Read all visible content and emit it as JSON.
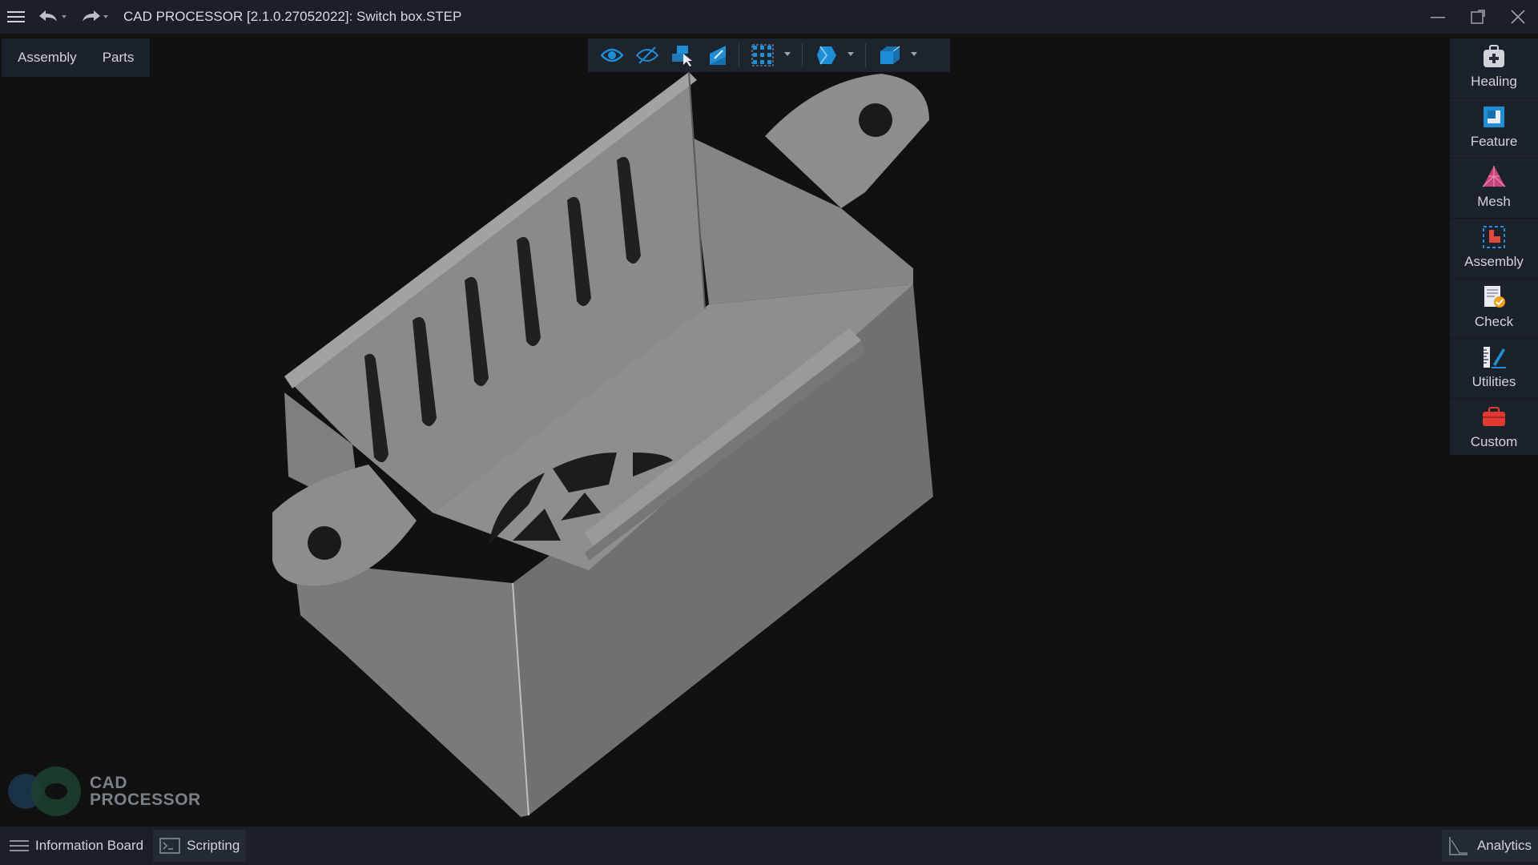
{
  "titlebar": {
    "title": "CAD PROCESSOR [2.1.0.27052022]:  Switch box.STEP",
    "icons": [
      "menu-icon",
      "undo-icon",
      "redo-icon",
      "minimize-icon",
      "restore-icon",
      "close-icon"
    ]
  },
  "left_tabs": [
    {
      "label": "Assembly"
    },
    {
      "label": "Parts"
    }
  ],
  "toolbar": {
    "icons": [
      "show-icon",
      "hide-icon",
      "select-icon",
      "section-icon",
      "grid-select-icon",
      "display-mode-icon",
      "view-cube-icon"
    ]
  },
  "right_panel": [
    {
      "label": "Healing",
      "icon": "healing-kit-icon"
    },
    {
      "label": "Feature",
      "icon": "feature-icon"
    },
    {
      "label": "Mesh",
      "icon": "mesh-icon"
    },
    {
      "label": "Assembly",
      "icon": "assembly-icon"
    },
    {
      "label": "Check",
      "icon": "check-icon"
    },
    {
      "label": "Utilities",
      "icon": "utilities-icon"
    },
    {
      "label": "Custom",
      "icon": "custom-toolbox-icon"
    }
  ],
  "logo": {
    "line1": "CAD",
    "line2": "PROCESSOR"
  },
  "statusbar": {
    "information_board": "Information Board",
    "scripting": "Scripting",
    "analytics": "Analytics"
  },
  "colors": {
    "accent": "#1e8fd6",
    "background": "#111111",
    "panel": "#1c222b",
    "model": "#8c8c8c"
  }
}
